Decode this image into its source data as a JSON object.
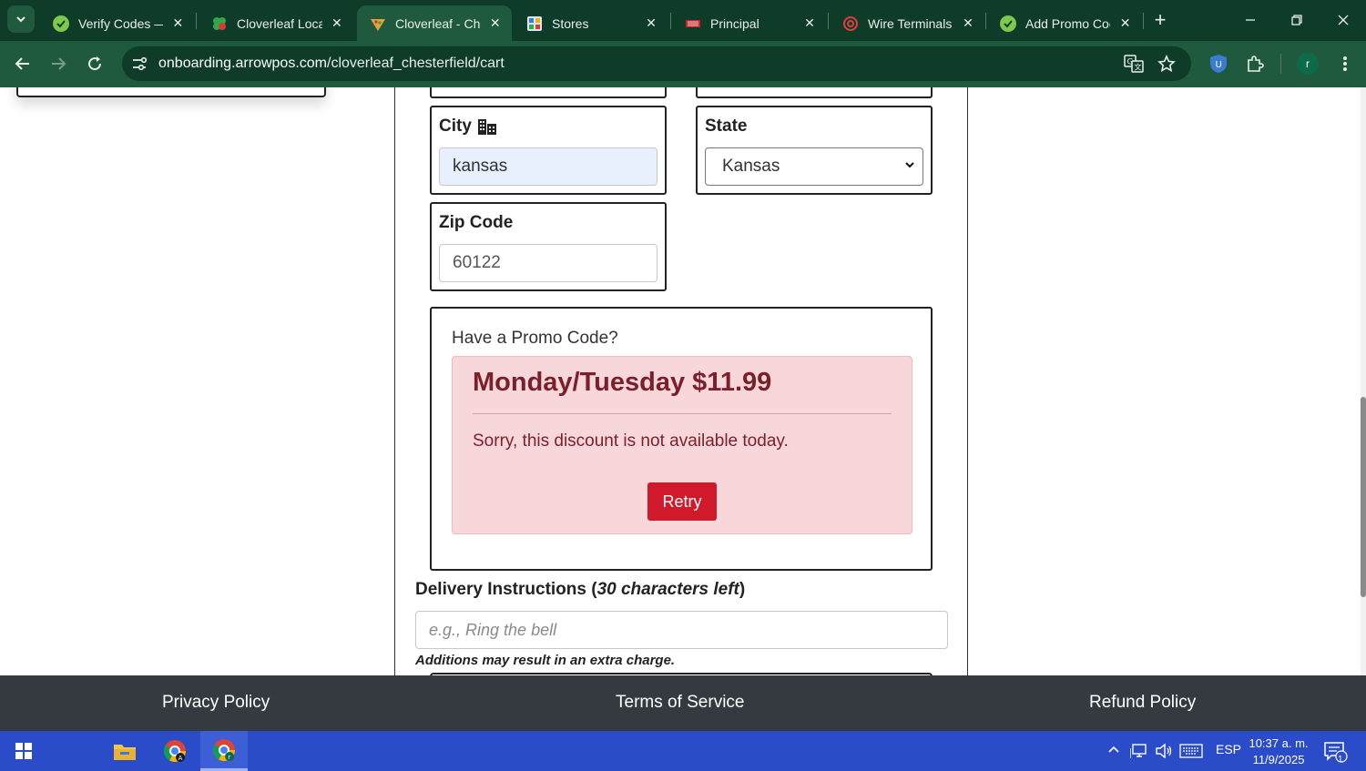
{
  "browser": {
    "tabs": [
      {
        "title": "Verify Codes — ",
        "active": false
      },
      {
        "title": "Cloverleaf Locati",
        "active": false
      },
      {
        "title": "Cloverleaf - Che",
        "active": true
      },
      {
        "title": "Stores",
        "active": false
      },
      {
        "title": "Principal",
        "active": false
      },
      {
        "title": "Wire Terminals C",
        "active": false
      },
      {
        "title": "Add Promo Cod",
        "active": false
      }
    ],
    "url_host": "onboarding.arrowpos.com",
    "url_path": "/cloverleaf_chesterfield/cart",
    "profile_initial": "r",
    "tab_close_glyph": "✕",
    "new_tab_glyph": "+"
  },
  "form": {
    "city_label": "City",
    "city_value": "kansas",
    "state_label": "State",
    "state_value": "Kansas",
    "zip_label": "Zip Code",
    "zip_value": "60122"
  },
  "promo": {
    "heading": "Have a Promo Code?",
    "alert_title": "Monday/Tuesday $11.99",
    "alert_message": "Sorry, this discount is not available today.",
    "retry_label": "Retry"
  },
  "delivery": {
    "label_prefix": "Delivery Instructions (",
    "label_emphasis": "30 characters left",
    "label_suffix": ")",
    "placeholder": "e.g., Ring the bell",
    "note": "Additions may result in an extra charge."
  },
  "footer": {
    "privacy": "Privacy Policy",
    "terms": "Terms of Service",
    "refund": "Refund Policy"
  },
  "taskbar": {
    "language": "ESP",
    "time": "10:37 a. m.",
    "date": "11/9/2025",
    "notification_count": "1"
  },
  "colors": {
    "chrome_dark": "#0e3c28",
    "chrome_toolbar": "#1f5a3f",
    "alert_bg": "#f8d7da",
    "alert_text": "#7b1f2a",
    "retry_button": "#d0192a",
    "footer_bg": "#343a40",
    "taskbar_bg": "#2a4cc8"
  }
}
